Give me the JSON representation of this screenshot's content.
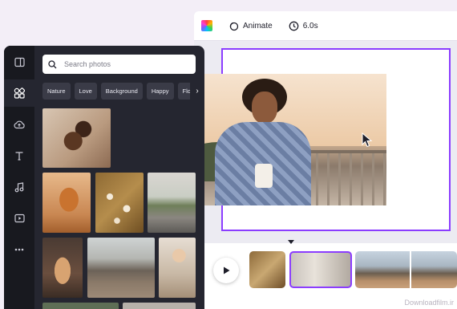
{
  "toolbar": {
    "animate_label": "Animate",
    "duration_label": "6.0s"
  },
  "sidebar": {
    "search_placeholder": "Search photos",
    "chips": [
      "Nature",
      "Love",
      "Background",
      "Happy",
      "Flowers"
    ],
    "rail_icons": [
      "layout-icon",
      "elements-icon",
      "upload-icon",
      "text-icon",
      "music-icon",
      "video-icon",
      "more-icon"
    ]
  },
  "colors": {
    "accent": "#8b3dff",
    "panel_bg": "#252630",
    "rail_bg": "#18191f"
  },
  "watermark": "Downloadfilm.ir"
}
